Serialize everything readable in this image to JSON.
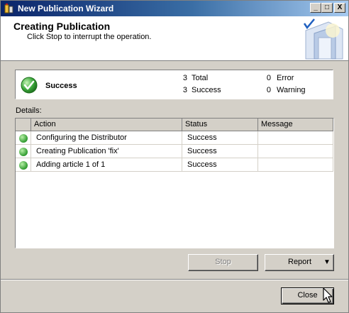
{
  "window": {
    "title": "New Publication Wizard",
    "controls": {
      "minimize": "_",
      "restore": "□",
      "close": "X"
    }
  },
  "header": {
    "title": "Creating Publication",
    "subtitle": "Click Stop to interrupt the operation."
  },
  "summary": {
    "status": "Success",
    "total_count": "3",
    "total_label": "Total",
    "success_count": "3",
    "success_label": "Success",
    "error_count": "0",
    "error_label": "Error",
    "warning_count": "0",
    "warning_label": "Warning"
  },
  "details": {
    "label": "Details:",
    "columns": [
      "Action",
      "Status",
      "Message"
    ],
    "rows": [
      {
        "action": "Configuring the Distributor",
        "status": "Success",
        "message": ""
      },
      {
        "action": "Creating Publication 'fix'",
        "status": "Success",
        "message": ""
      },
      {
        "action": "Adding article 1 of 1",
        "status": "Success",
        "message": ""
      }
    ]
  },
  "buttons": {
    "stop": "Stop",
    "report": "Report",
    "report_arrow": "▼",
    "close": "Close"
  },
  "colors": {
    "titlebar_start": "#0a246a",
    "titlebar_end": "#a6caf0",
    "dialog_bg": "#d4d0c8",
    "success_green": "#2e9a2e"
  }
}
